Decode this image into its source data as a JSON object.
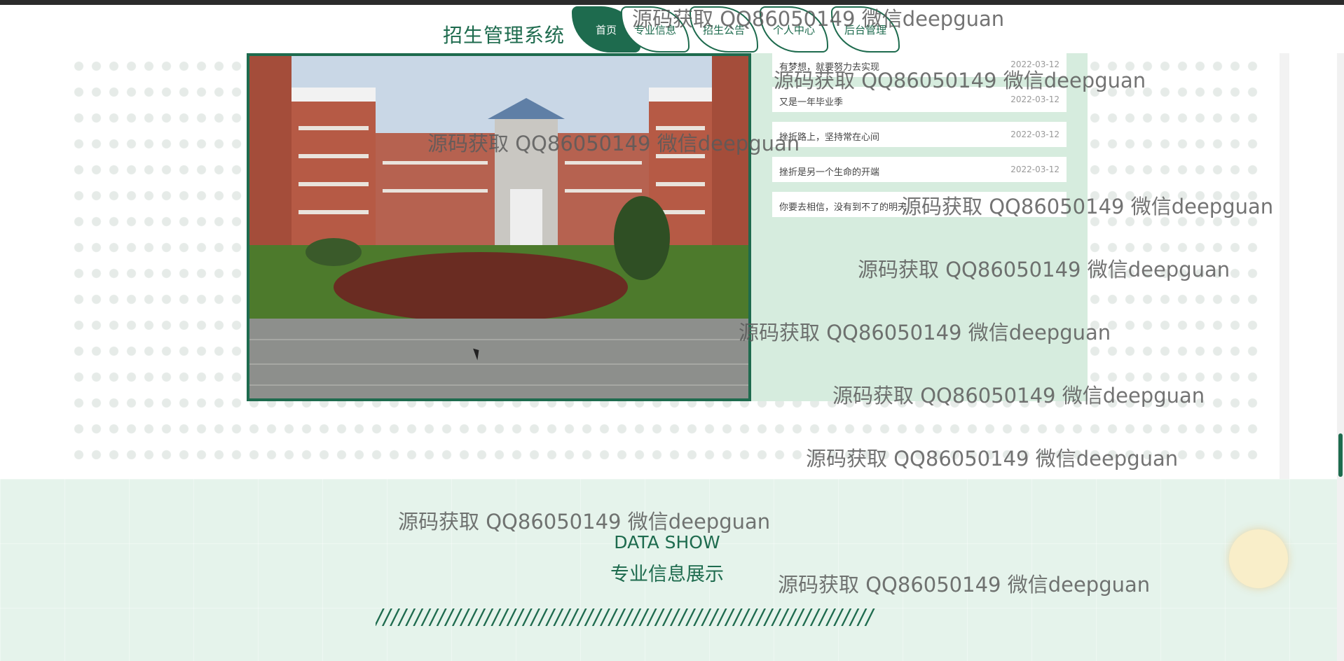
{
  "header": {
    "logo": "招生管理系统",
    "nav": [
      {
        "label": "首页",
        "active": true
      },
      {
        "label": "专业信息",
        "active": false
      },
      {
        "label": "招生公告",
        "active": false
      },
      {
        "label": "个人中心",
        "active": false
      },
      {
        "label": "后台管理",
        "active": false
      }
    ]
  },
  "news": [
    {
      "title": "有梦想，就要努力去实现",
      "date": "2022-03-12"
    },
    {
      "title": "又是一年毕业季",
      "date": "2022-03-12"
    },
    {
      "title": "挫折路上，坚持常在心间",
      "date": "2022-03-12"
    },
    {
      "title": "挫折是另一个生命的开端",
      "date": "2022-03-12"
    },
    {
      "title": "你要去相信，没有到不了的明天",
      "date": ""
    }
  ],
  "section": {
    "title_en": "DATA SHOW",
    "title_cn": "专业信息展示",
    "divider": "////////////////////////////////////////////////////////////////"
  },
  "watermark": "源码获取 QQ86050149 微信deepguan",
  "colors": {
    "accent": "#1e6b4e",
    "panel": "#d6ecde",
    "lower_bg": "#e5f3eb"
  }
}
